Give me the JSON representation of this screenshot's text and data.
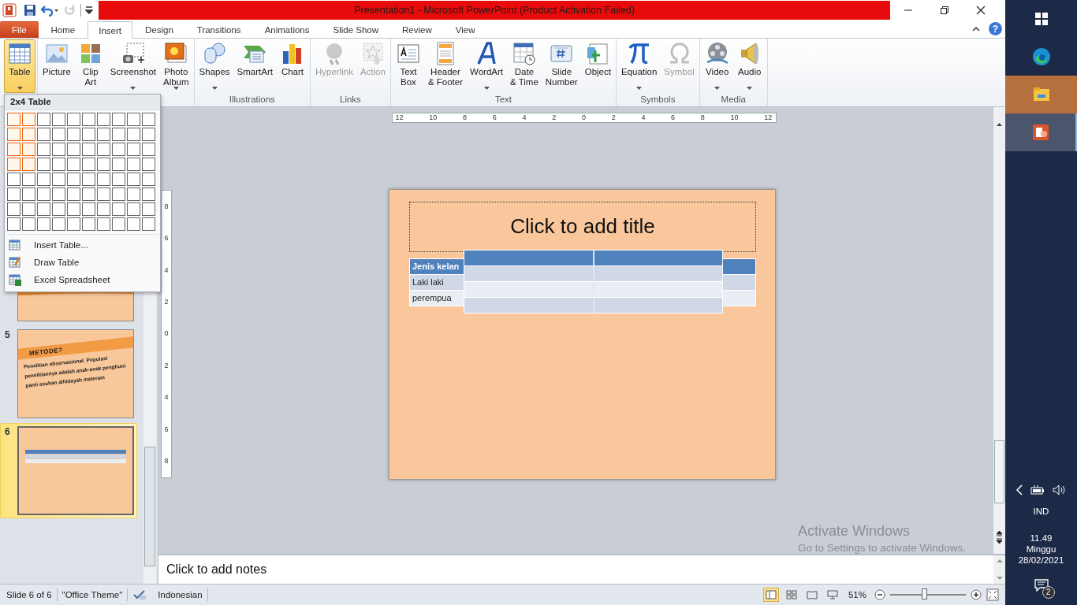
{
  "quick_access": [
    {
      "kind": "save",
      "disabled": false,
      "menu": false
    },
    {
      "kind": "undo",
      "disabled": false,
      "menu": true
    },
    {
      "kind": "redo",
      "disabled": true,
      "menu": false
    },
    {
      "kind": "customize",
      "disabled": false,
      "menu": false
    }
  ],
  "window": {
    "title": "Presentation1 - Microsoft PowerPoint (Product Activation Failed)"
  },
  "tabs": [
    {
      "label": "File",
      "kind": "backstage",
      "selected": false
    },
    {
      "label": "Home",
      "kind": "tab",
      "selected": false
    },
    {
      "label": "Insert",
      "kind": "tab",
      "selected": true
    },
    {
      "label": "Design",
      "kind": "tab",
      "selected": false
    },
    {
      "label": "Transitions",
      "kind": "tab",
      "selected": false
    },
    {
      "label": "Animations",
      "kind": "tab",
      "selected": false
    },
    {
      "label": "Slide Show",
      "kind": "tab",
      "selected": false
    },
    {
      "label": "Review",
      "kind": "tab",
      "selected": false
    },
    {
      "label": "View",
      "kind": "tab",
      "selected": false
    }
  ],
  "help": "?",
  "ribbon_groups": [
    {
      "buttons": [
        {
          "kind": "table",
          "label": "Table",
          "menu": true,
          "disabled": false,
          "selected": true
        }
      ]
    },
    {
      "buttons": [
        {
          "kind": "picture",
          "label": "Picture",
          "menu": false,
          "disabled": false,
          "selected": false
        },
        {
          "kind": "clipart",
          "label": "Clip\nArt",
          "menu": false,
          "disabled": false,
          "selected": false
        },
        {
          "kind": "screenshot",
          "label": "Screenshot",
          "menu": true,
          "disabled": false,
          "selected": false
        },
        {
          "kind": "album",
          "label": "Photo\nAlbum",
          "menu": true,
          "disabled": false,
          "selected": false
        }
      ]
    },
    {
      "label": "Illustrations",
      "buttons": [
        {
          "kind": "shapes",
          "label": "Shapes",
          "menu": true,
          "disabled": false,
          "selected": false
        },
        {
          "kind": "smartart",
          "label": "SmartArt",
          "menu": false,
          "disabled": false,
          "selected": false
        },
        {
          "kind": "chart",
          "label": "Chart",
          "menu": false,
          "disabled": false,
          "selected": false
        }
      ]
    },
    {
      "label": "Links",
      "buttons": [
        {
          "kind": "hyperlink",
          "label": "Hyperlink",
          "menu": false,
          "disabled": true,
          "selected": false
        },
        {
          "kind": "action",
          "label": "Action",
          "menu": false,
          "disabled": true,
          "selected": false
        }
      ]
    },
    {
      "label": "Text",
      "buttons": [
        {
          "kind": "textbox",
          "label": "Text\nBox",
          "menu": false,
          "disabled": false,
          "selected": false
        },
        {
          "kind": "header",
          "label": "Header\n& Footer",
          "menu": false,
          "disabled": false,
          "selected": false
        },
        {
          "kind": "wordart",
          "label": "WordArt",
          "menu": true,
          "disabled": false,
          "selected": false
        },
        {
          "kind": "datetime",
          "label": "Date\n& Time",
          "menu": false,
          "disabled": false,
          "selected": false
        },
        {
          "kind": "slidenumber",
          "label": "Slide\nNumber",
          "menu": false,
          "disabled": false,
          "selected": false
        },
        {
          "kind": "object",
          "label": "Object",
          "menu": false,
          "disabled": false,
          "selected": false
        }
      ]
    },
    {
      "label": "Symbols",
      "buttons": [
        {
          "kind": "equation",
          "label": "Equation",
          "menu": true,
          "disabled": false,
          "selected": false
        },
        {
          "kind": "symbol",
          "label": "Symbol",
          "menu": false,
          "disabled": true,
          "selected": false
        }
      ]
    },
    {
      "label": "Media",
      "buttons": [
        {
          "kind": "video",
          "label": "Video",
          "menu": true,
          "disabled": false,
          "selected": false
        },
        {
          "kind": "audio",
          "label": "Audio",
          "menu": true,
          "disabled": false,
          "selected": false
        }
      ]
    }
  ],
  "table_menu": {
    "title": "2x4 Table",
    "grid": [
      {
        "cells": [
          {
            "selected": true
          },
          {
            "selected": true
          },
          {
            "selected": false
          },
          {
            "selected": false
          },
          {
            "selected": false
          },
          {
            "selected": false
          },
          {
            "selected": false
          },
          {
            "selected": false
          },
          {
            "selected": false
          },
          {
            "selected": false
          }
        ]
      },
      {
        "cells": [
          {
            "selected": true
          },
          {
            "selected": true
          },
          {
            "selected": false
          },
          {
            "selected": false
          },
          {
            "selected": false
          },
          {
            "selected": false
          },
          {
            "selected": false
          },
          {
            "selected": false
          },
          {
            "selected": false
          },
          {
            "selected": false
          }
        ]
      },
      {
        "cells": [
          {
            "selected": true
          },
          {
            "selected": true
          },
          {
            "selected": false
          },
          {
            "selected": false
          },
          {
            "selected": false
          },
          {
            "selected": false
          },
          {
            "selected": false
          },
          {
            "selected": false
          },
          {
            "selected": false
          },
          {
            "selected": false
          }
        ]
      },
      {
        "cells": [
          {
            "selected": true
          },
          {
            "selected": true
          },
          {
            "selected": false
          },
          {
            "selected": false
          },
          {
            "selected": false
          },
          {
            "selected": false
          },
          {
            "selected": false
          },
          {
            "selected": false
          },
          {
            "selected": false
          },
          {
            "selected": false
          }
        ]
      },
      {
        "cells": [
          {
            "selected": false
          },
          {
            "selected": false
          },
          {
            "selected": false
          },
          {
            "selected": false
          },
          {
            "selected": false
          },
          {
            "selected": false
          },
          {
            "selected": false
          },
          {
            "selected": false
          },
          {
            "selected": false
          },
          {
            "selected": false
          }
        ]
      },
      {
        "cells": [
          {
            "selected": false
          },
          {
            "selected": false
          },
          {
            "selected": false
          },
          {
            "selected": false
          },
          {
            "selected": false
          },
          {
            "selected": false
          },
          {
            "selected": false
          },
          {
            "selected": false
          },
          {
            "selected": false
          },
          {
            "selected": false
          }
        ]
      },
      {
        "cells": [
          {
            "selected": false
          },
          {
            "selected": false
          },
          {
            "selected": false
          },
          {
            "selected": false
          },
          {
            "selected": false
          },
          {
            "selected": false
          },
          {
            "selected": false
          },
          {
            "selected": false
          },
          {
            "selected": false
          },
          {
            "selected": false
          }
        ]
      },
      {
        "cells": [
          {
            "selected": false
          },
          {
            "selected": false
          },
          {
            "selected": false
          },
          {
            "selected": false
          },
          {
            "selected": false
          },
          {
            "selected": false
          },
          {
            "selected": false
          },
          {
            "selected": false
          },
          {
            "selected": false
          },
          {
            "selected": false
          }
        ]
      }
    ],
    "items": [
      {
        "kind": "insert",
        "label": "Insert Table..."
      },
      {
        "kind": "draw",
        "label": "Draw Table"
      },
      {
        "kind": "excel",
        "label": "Excel Spreadsheet"
      }
    ]
  },
  "slides": [
    {
      "kind": "stripe",
      "selected": false
    },
    {
      "number": "5",
      "kind": "heading",
      "heading": "METODE?",
      "bullet": "Penelitian observasional. Populasi penelitiannya adalah anak-anak penghuni panti asuhan alhidayah materam",
      "selected": false
    },
    {
      "number": "6",
      "kind": "table",
      "selected": true
    }
  ],
  "ruler": {
    "horizontal": [
      "12",
      "10",
      "8",
      "6",
      "4",
      "2",
      "0",
      "2",
      "4",
      "6",
      "8",
      "10",
      "12"
    ],
    "vertical": [
      "8",
      "6",
      "4",
      "2",
      "0",
      "2",
      "4",
      "6",
      "8"
    ]
  },
  "slide": {
    "title_placeholder": "Click to add title",
    "table": {
      "rows": [
        {
          "kind": "header",
          "cells": [
            "Jenis kelan"
          ]
        },
        {
          "kind": "band",
          "cells": [
            "Laki laki"
          ]
        },
        {
          "kind": "plain",
          "cells": [
            "perempua"
          ]
        }
      ]
    }
  },
  "notes": {
    "text": "Click to add notes"
  },
  "activation": {
    "title": "Activate Windows",
    "message": "Go to Settings to activate Windows."
  },
  "status_bar": {
    "slide": "Slide 6 of 6",
    "theme": "\"Office Theme\"",
    "language": "Indonesian",
    "views": [
      {
        "kind": "normal",
        "selected": true
      },
      {
        "kind": "sorter",
        "selected": false
      },
      {
        "kind": "reading",
        "selected": false
      },
      {
        "kind": "slideshow",
        "selected": false
      }
    ],
    "zoom": "51%",
    "zoom_slider": {
      "level": 0.45
    }
  },
  "taskbar": {
    "apps": [
      {
        "kind": "start",
        "selected": false,
        "flashing": false
      },
      {
        "kind": "edge",
        "selected": false,
        "flashing": false
      },
      {
        "kind": "explorer",
        "selected": false,
        "flashing": true
      },
      {
        "kind": "powerpoint",
        "selected": true,
        "flashing": false
      }
    ],
    "language": "IND",
    "time": "11.49",
    "day": "Minggu",
    "date": "28/02/2021",
    "notifications": "2"
  }
}
